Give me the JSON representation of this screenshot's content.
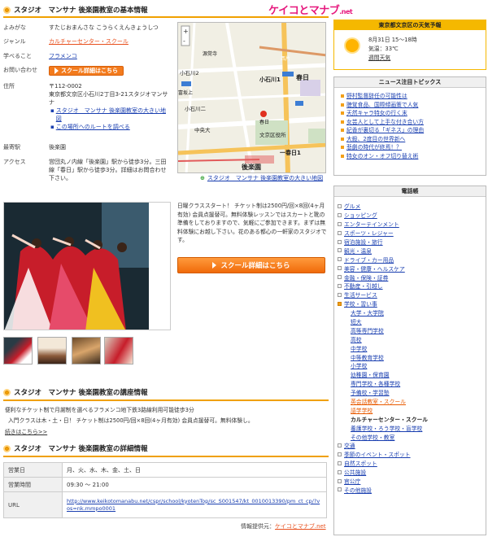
{
  "logo": {
    "text": "ケイコとマナブ",
    "suffix": ".net"
  },
  "basic": {
    "title": "スタジオ　マンサナ 後楽園教室の基本情報",
    "rows": [
      {
        "label": "よみがな",
        "value": "すたじおまんさな こうらくえんきょうしつ"
      },
      {
        "label": "ジャンル",
        "value": "カルチャーセンター・スクール"
      },
      {
        "label": "学べること",
        "value": "フラメンコ"
      },
      {
        "label": "お問い合わせ",
        "value": "スクール詳細はこちら"
      }
    ],
    "address_label": "住所",
    "postal": "〒112-0002",
    "address": "東京都文京区小石川2丁目3-21スタジオマンサナ",
    "map_link": "スタジオ　マンサナ 後楽園教室の大きい地図",
    "route_link": "この場所へのルートを調べる",
    "station_label": "最寄駅",
    "station": "後楽園",
    "access_label": "アクセス",
    "access": "営団丸ノ内線「後楽園」駅から徒歩3分。三田線「春日」駅から徒歩3分。詳細はお問合わせ下さい。"
  },
  "map": {
    "labels": [
      "小石川2",
      "小石川1",
      "春日",
      "小石川二",
      "中央大",
      "文京区役所",
      "後楽園",
      "富坂上",
      "一春日1",
      "源覚寺",
      "西片",
      "春日"
    ],
    "caption": "スタジオ　マンサナ 後楽園教室の大きい地図"
  },
  "desc": "日曜クラススタート！ チケット制は2500円/回×8回(4ヶ月有効) 会員点援替可。無料体験レッスンではスカートと靴の準備をしておりますので、気軽にご参加できます。まずは無料体験にお越し下さい。花のある都心の一軒家のスタジオです。",
  "detail_btn": "スクール詳細はこちら",
  "course": {
    "title": "スタジオ　マンサナ 後楽園教室の講座情報",
    "line1": "便利なチケット制で月謝制を選べるフラメンコ地下鉄3路線利用可能徒歩3分",
    "line2": "入門クラスは木・土・日！ チケット制は2500円/回×8回(4ヶ月有効) 会員点援替可。無料体験し。",
    "more": "続きはこちら>>"
  },
  "detail": {
    "title": "スタジオ　マンサナ 後楽園教室の詳細情報",
    "rows": [
      {
        "label": "営業日",
        "value": "月、火、水、木、金、土、日"
      },
      {
        "label": "営業時間",
        "value": "09:30 ～ 21:00"
      },
      {
        "label": "URL",
        "value": "http://www.keikotomanabu.net/cspr/school/kyotenTop/sc_S001547/kt_0010013390/pm_ct_cp/?vos=nk.mmpo0001"
      }
    ]
  },
  "credit_label": "情報提供元：",
  "credit_link": "ケイコとマナブ.net",
  "weather": {
    "title": "東京都文京区の天気予報",
    "date": "8月31日 15～18時",
    "temp": "気温：33℃",
    "link": "週間天気"
  },
  "news": {
    "title": "ニュース注目トピックス",
    "items": [
      "野村監督辞任の可能性は",
      "聴覚食品、国際傾画策で人気",
      "天然キャラ特女の行く末",
      "女芸人として上手な付き合い方",
      "紀香が裏切る「ギネス」の理由",
      "大殺、2度目の世界新へ",
      "悲劇の時代が終焉！？",
      "特女のオン・オフ切り替え術"
    ]
  },
  "phone": {
    "title": "電話帳",
    "items": [
      {
        "label": "グルメ",
        "level": 0
      },
      {
        "label": "ショッピング",
        "level": 0
      },
      {
        "label": "エンターテインメント",
        "level": 0
      },
      {
        "label": "スポーツ・レジャー",
        "level": 0
      },
      {
        "label": "宿泊施設・旅行",
        "level": 0
      },
      {
        "label": "観光・温泉",
        "level": 0
      },
      {
        "label": "ドライブ・カー用品",
        "level": 0
      },
      {
        "label": "美容・健康・ヘルスケア",
        "level": 0
      },
      {
        "label": "金融・保険・証券",
        "level": 0
      },
      {
        "label": "不動産・引越し",
        "level": 0
      },
      {
        "label": "生活サービス",
        "level": 0
      },
      {
        "label": "学校・習い事",
        "level": 0,
        "open": true
      },
      {
        "label": "大学・大学院",
        "level": 1
      },
      {
        "label": "短大",
        "level": 1
      },
      {
        "label": "高等専門学校",
        "level": 1
      },
      {
        "label": "高校",
        "level": 1
      },
      {
        "label": "中学校",
        "level": 1
      },
      {
        "label": "中等教育学校",
        "level": 1
      },
      {
        "label": "小学校",
        "level": 1
      },
      {
        "label": "幼稚園・保育園",
        "level": 1
      },
      {
        "label": "専門学校・各種学校",
        "level": 1
      },
      {
        "label": "予備校・学習塾",
        "level": 1
      },
      {
        "label": "英会話教室・スクール",
        "level": 1,
        "active": true
      },
      {
        "label": "語学学校",
        "level": 1,
        "active": true
      },
      {
        "label": "カルチャーセンター・スクール",
        "level": 1,
        "current": true
      },
      {
        "label": "養護学校・ろう学校・盲学校",
        "level": 1
      },
      {
        "label": "その他学校・教室",
        "level": 1
      },
      {
        "label": "交通",
        "level": 0
      },
      {
        "label": "季節のイベント・スポット",
        "level": 0
      },
      {
        "label": "自然スポット",
        "level": 0
      },
      {
        "label": "公共施設",
        "level": 0
      },
      {
        "label": "官公庁",
        "level": 0
      },
      {
        "label": "その他施設",
        "level": 0
      }
    ]
  }
}
